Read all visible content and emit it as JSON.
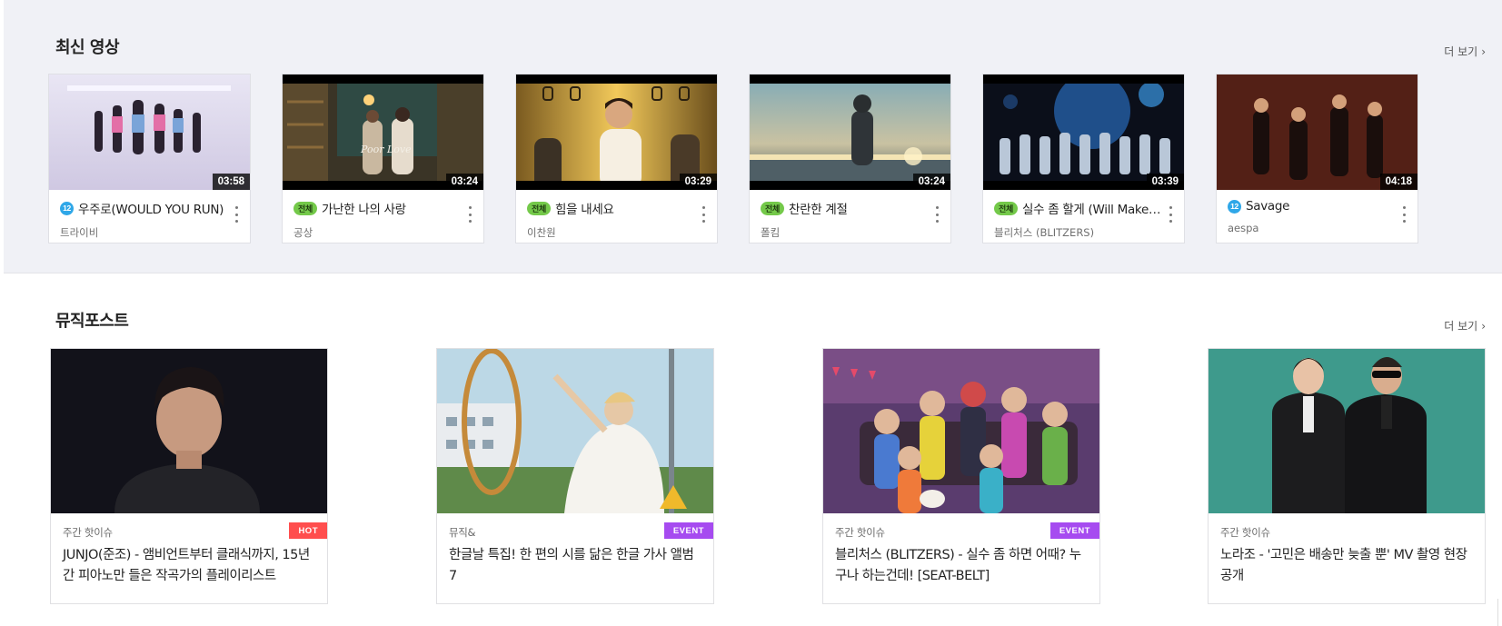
{
  "latest_videos": {
    "title": "최신 영상",
    "more_label": "더 보기",
    "items": [
      {
        "title": "우주로(WOULD YOU RUN)",
        "artist": "트라이비",
        "duration": "03:58",
        "rating_label": "12"
      },
      {
        "title": "가난한 나의 사랑",
        "artist": "공상",
        "duration": "03:24",
        "rating_label": "전체"
      },
      {
        "title": "힘을 내세요",
        "artist": "이찬원",
        "duration": "03:29",
        "rating_label": "전체"
      },
      {
        "title": "찬란한 계절",
        "artist": "폴킴",
        "duration": "03:24",
        "rating_label": "전체"
      },
      {
        "title": "실수 좀 할게 (Will Make …",
        "artist": "블리처스 (BLITZERS)",
        "duration": "03:39",
        "rating_label": "전체"
      },
      {
        "title": "Savage",
        "artist": "aespa",
        "duration": "04:18",
        "rating_label": "12"
      }
    ],
    "image_text": {
      "poor_love": "Poor Love"
    }
  },
  "music_post": {
    "title": "뮤직포스트",
    "more_label": "더 보기",
    "items": [
      {
        "category": "주간 핫이슈",
        "badge": "HOT",
        "title": "JUNJO(준조) - 앰비언트부터 클래식까지, 15년간 피아노만 들은 작곡가의 플레이리스트"
      },
      {
        "category": "뮤직&",
        "badge": "EVENT",
        "title": "한글날 특집! 한 편의 시를 닮은 한글 가사 앨범 7"
      },
      {
        "category": "주간 핫이슈",
        "badge": "EVENT",
        "title": "블리처스 (BLITZERS) - 실수 좀 하면 어때? 누구나 하는건데! [SEAT-BELT]"
      },
      {
        "category": "주간 핫이슈",
        "badge": "",
        "title": "노라조 - '고민은 배송만 늦출 뿐' MV 촬영 현장 공개"
      }
    ]
  },
  "colors": {
    "section_bg": "#f0f1f6",
    "rating_12": "#2fa7e8",
    "rating_all": "#74c94a",
    "badge_hot": "#ff4e4e",
    "badge_event": "#a64bf0"
  },
  "icons": [
    "chevron-right-icon",
    "more-vertical-icon",
    "rating-12-icon",
    "rating-all-icon"
  ]
}
